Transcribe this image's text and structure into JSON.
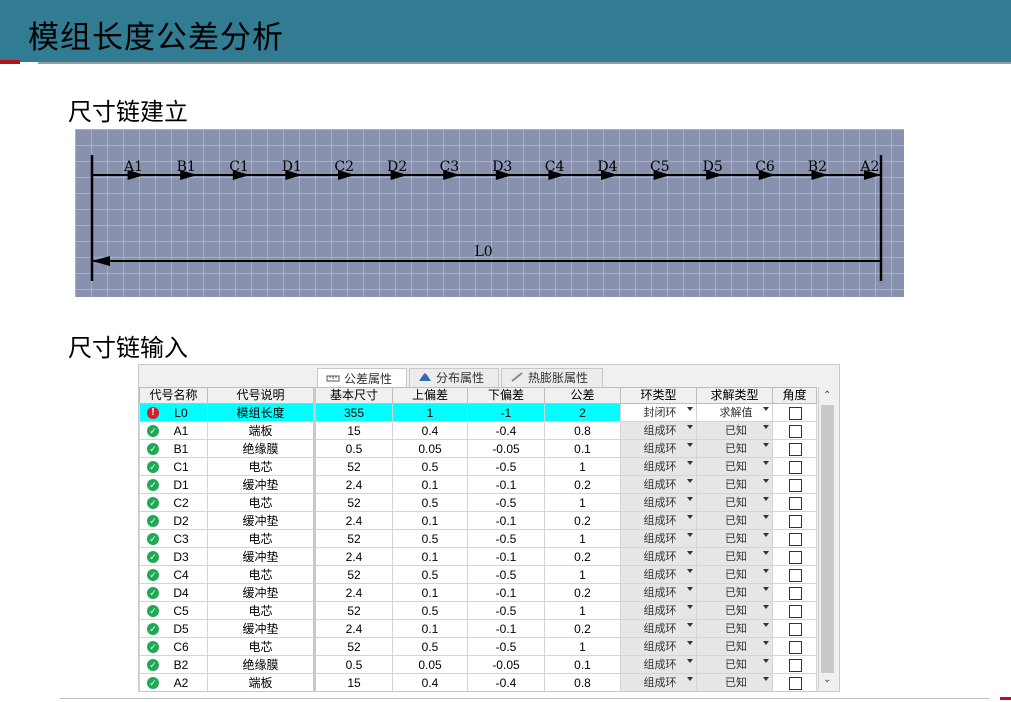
{
  "slide": {
    "title": "模组长度公差分析",
    "section1": "尺寸链建立",
    "section2": "尺寸链输入"
  },
  "chain": {
    "segments": [
      "A1",
      "B1",
      "C1",
      "D1",
      "C2",
      "D2",
      "C3",
      "D3",
      "C4",
      "D4",
      "C5",
      "D5",
      "C6",
      "B2",
      "A2"
    ],
    "closing_label": "L0"
  },
  "tabs": [
    {
      "label": "公差属性",
      "icon": "ruler-icon",
      "active": true
    },
    {
      "label": "分布属性",
      "icon": "distribution-chart-icon",
      "active": false
    },
    {
      "label": "热膨胀属性",
      "icon": "pencil-icon",
      "active": false
    }
  ],
  "columns": {
    "code": "代号名称",
    "desc": "代号说明",
    "basic": "基本尺寸",
    "upper": "上偏差",
    "lower": "下偏差",
    "tol": "公差",
    "ring": "环类型",
    "solve": "求解类型",
    "angle": "角度"
  },
  "colors": {
    "title_bar": "#317b93",
    "highlight_row": "#00ffff",
    "ok_status": "#21a854",
    "error_status": "#d61f26"
  },
  "rows": [
    {
      "status": "error",
      "code": "L0",
      "desc": "模组长度",
      "basic": "355",
      "upper": "1",
      "lower": "-1",
      "tol": "2",
      "ring": "封闭环",
      "solve": "求解值",
      "editable": true
    },
    {
      "status": "ok",
      "code": "A1",
      "desc": "端板",
      "basic": "15",
      "upper": "0.4",
      "lower": "-0.4",
      "tol": "0.8",
      "ring": "组成环",
      "solve": "已知"
    },
    {
      "status": "ok",
      "code": "B1",
      "desc": "绝缘膜",
      "basic": "0.5",
      "upper": "0.05",
      "lower": "-0.05",
      "tol": "0.1",
      "ring": "组成环",
      "solve": "已知"
    },
    {
      "status": "ok",
      "code": "C1",
      "desc": "电芯",
      "basic": "52",
      "upper": "0.5",
      "lower": "-0.5",
      "tol": "1",
      "ring": "组成环",
      "solve": "已知"
    },
    {
      "status": "ok",
      "code": "D1",
      "desc": "缓冲垫",
      "basic": "2.4",
      "upper": "0.1",
      "lower": "-0.1",
      "tol": "0.2",
      "ring": "组成环",
      "solve": "已知"
    },
    {
      "status": "ok",
      "code": "C2",
      "desc": "电芯",
      "basic": "52",
      "upper": "0.5",
      "lower": "-0.5",
      "tol": "1",
      "ring": "组成环",
      "solve": "已知"
    },
    {
      "status": "ok",
      "code": "D2",
      "desc": "缓冲垫",
      "basic": "2.4",
      "upper": "0.1",
      "lower": "-0.1",
      "tol": "0.2",
      "ring": "组成环",
      "solve": "已知"
    },
    {
      "status": "ok",
      "code": "C3",
      "desc": "电芯",
      "basic": "52",
      "upper": "0.5",
      "lower": "-0.5",
      "tol": "1",
      "ring": "组成环",
      "solve": "已知"
    },
    {
      "status": "ok",
      "code": "D3",
      "desc": "缓冲垫",
      "basic": "2.4",
      "upper": "0.1",
      "lower": "-0.1",
      "tol": "0.2",
      "ring": "组成环",
      "solve": "已知"
    },
    {
      "status": "ok",
      "code": "C4",
      "desc": "电芯",
      "basic": "52",
      "upper": "0.5",
      "lower": "-0.5",
      "tol": "1",
      "ring": "组成环",
      "solve": "已知"
    },
    {
      "status": "ok",
      "code": "D4",
      "desc": "缓冲垫",
      "basic": "2.4",
      "upper": "0.1",
      "lower": "-0.1",
      "tol": "0.2",
      "ring": "组成环",
      "solve": "已知"
    },
    {
      "status": "ok",
      "code": "C5",
      "desc": "电芯",
      "basic": "52",
      "upper": "0.5",
      "lower": "-0.5",
      "tol": "1",
      "ring": "组成环",
      "solve": "已知"
    },
    {
      "status": "ok",
      "code": "D5",
      "desc": "缓冲垫",
      "basic": "2.4",
      "upper": "0.1",
      "lower": "-0.1",
      "tol": "0.2",
      "ring": "组成环",
      "solve": "已知"
    },
    {
      "status": "ok",
      "code": "C6",
      "desc": "电芯",
      "basic": "52",
      "upper": "0.5",
      "lower": "-0.5",
      "tol": "1",
      "ring": "组成环",
      "solve": "已知"
    },
    {
      "status": "ok",
      "code": "B2",
      "desc": "绝缘膜",
      "basic": "0.5",
      "upper": "0.05",
      "lower": "-0.05",
      "tol": "0.1",
      "ring": "组成环",
      "solve": "已知"
    },
    {
      "status": "ok",
      "code": "A2",
      "desc": "端板",
      "basic": "15",
      "upper": "0.4",
      "lower": "-0.4",
      "tol": "0.8",
      "ring": "组成环",
      "solve": "已知"
    }
  ]
}
